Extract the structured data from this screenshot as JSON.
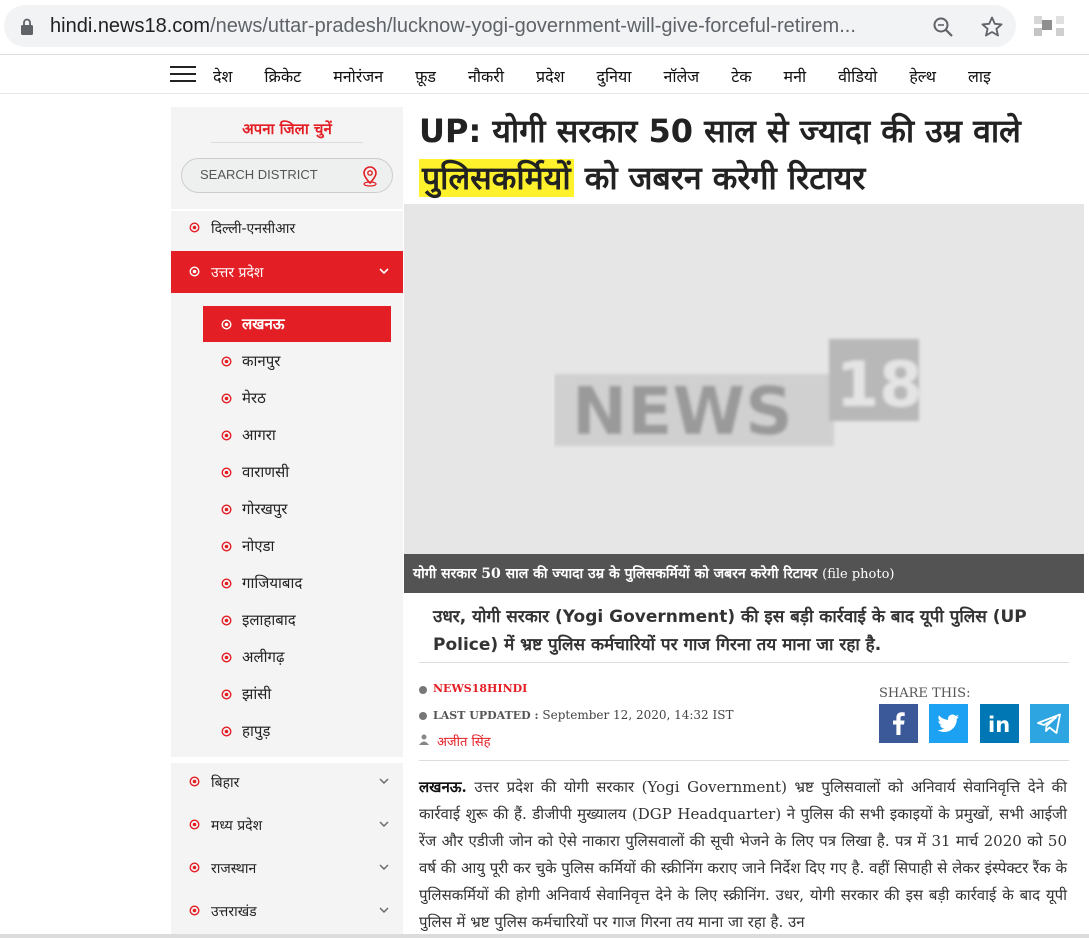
{
  "browser": {
    "url_domain": "hindi.news18.com",
    "url_path": "/news/uttar-pradesh/lucknow-yogi-government-will-give-forceful-retirem..."
  },
  "nav": {
    "items": [
      "देश",
      "क्रिकेट",
      "मनोरंजन",
      "फ़ूड",
      "नौकरी",
      "प्रदेश",
      "दुनिया",
      "नॉलेज",
      "टेक",
      "मनी",
      "वीडियो",
      "हेल्थ",
      "लाइ"
    ]
  },
  "sidebar": {
    "title": "अपना जिला चुनें",
    "search_placeholder": "SEARCH DISTRICT",
    "states_top": [
      {
        "label": "दिल्ली-एनसीआर"
      },
      {
        "label": "उत्तर प्रदेश"
      }
    ],
    "districts": [
      {
        "label": "लखनऊ"
      },
      {
        "label": "कानपुर"
      },
      {
        "label": "मेरठ"
      },
      {
        "label": "आगरा"
      },
      {
        "label": "वाराणसी"
      },
      {
        "label": "गोरखपुर"
      },
      {
        "label": "नोएडा"
      },
      {
        "label": "गाजियाबाद"
      },
      {
        "label": "इलाहाबाद"
      },
      {
        "label": "अलीगढ़"
      },
      {
        "label": "झांसी"
      },
      {
        "label": "हापुड़"
      }
    ],
    "states_bottom": [
      {
        "label": "बिहार"
      },
      {
        "label": "मध्य प्रदेश"
      },
      {
        "label": "राजस्थान"
      },
      {
        "label": "उत्तराखंड"
      }
    ]
  },
  "article": {
    "headline_part1": "UP: योगी सरकार 50 साल से ज्यादा की उम्र वाले ",
    "headline_highlight": "पुलिसकर्मियों",
    "headline_part2": " को जबरन करेगी रिटायर",
    "image_logo_text": "NEWS",
    "image_logo_num": "18",
    "caption": "योगी सरकार 50 साल की ज्यादा उम्र के पुलिसकर्मियों को जबरन करेगी रिटायर",
    "caption_note": "(file photo)",
    "summary": "उधर, योगी सरकार (Yogi Government) की इस बड़ी कार्रवाई के बाद यूपी पुलिस (UP Police) में भ्रष्ट पुलिस कर्मचारियों पर गाज गिरना तय माना जा रहा है.",
    "source": "NEWS18HINDI",
    "updated_label": "LAST UPDATED :",
    "updated_value": "September 12, 2020, 14:32 IST",
    "author": "अजीत सिंह",
    "share_label": "SHARE THIS:",
    "body_lead": "लखनऊ.",
    "body": " उत्तर प्रदेश की योगी सरकार (Yogi Government) भ्रष्ट पुलिसवालों को अनिवार्य सेवानिवृत्ति देने की कार्रवाई शुरू की हैं. डीजीपी मुख्यालय (DGP Headquarter) ने पुलिस की सभी इकाइयों के प्रमुखों, सभी आईजी रेंज और एडीजी जोन को ऐसे नाकारा पुलिसवालों की सूची भेजने के लिए पत्र लिखा है. पत्र में 31 मार्च 2020 को 50 वर्ष की आयु पूरी कर चुके पुलिस कर्मियों की स्क्रीनिंग कराए जाने निर्देश दिए गए है. वहीं सिपाही से लेकर इंस्पेक्टर रैंक के पुलिसकर्मियों की होगी अनिवार्य सेवानिवृत्त देने के लिए स्क्रीनिंग. उधर, योगी सरकार की इस बड़ी कार्रवाई के बाद यूपी पुलिस में भ्रष्ट पुलिस कर्मचारियों पर गाज गिरना तय माना जा रहा है. उन"
  },
  "colors": {
    "brand_red": "#e31e24",
    "highlight": "#fff22c",
    "facebook": "#3b5998",
    "twitter": "#1da1f2",
    "linkedin": "#0077b5",
    "telegram": "#2ca5e0"
  }
}
